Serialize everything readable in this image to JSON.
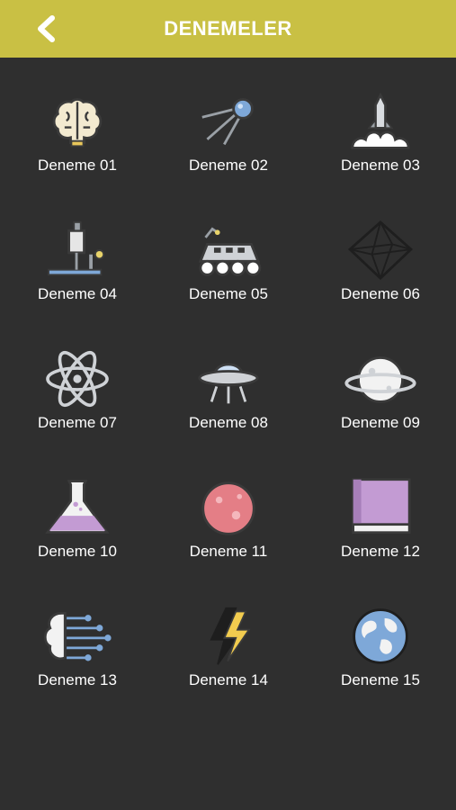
{
  "header": {
    "title": "DENEMELER",
    "back_icon": "chevron-left-icon",
    "background": "#c9c044"
  },
  "tests": [
    {
      "label": "Deneme 01",
      "icon": "brain-icon"
    },
    {
      "label": "Deneme 02",
      "icon": "satellite-icon"
    },
    {
      "label": "Deneme 03",
      "icon": "rocket-launch-icon"
    },
    {
      "label": "Deneme 04",
      "icon": "microscope-icon"
    },
    {
      "label": "Deneme 05",
      "icon": "rover-icon"
    },
    {
      "label": "Deneme 06",
      "icon": "octahedron-icon"
    },
    {
      "label": "Deneme 07",
      "icon": "atom-icon"
    },
    {
      "label": "Deneme 08",
      "icon": "ufo-icon"
    },
    {
      "label": "Deneme 09",
      "icon": "planet-ring-icon"
    },
    {
      "label": "Deneme 10",
      "icon": "flask-icon"
    },
    {
      "label": "Deneme 11",
      "icon": "planet-icon"
    },
    {
      "label": "Deneme 12",
      "icon": "book-icon"
    },
    {
      "label": "Deneme 13",
      "icon": "ai-brain-icon"
    },
    {
      "label": "Deneme 14",
      "icon": "lightning-icon"
    },
    {
      "label": "Deneme 15",
      "icon": "globe-icon"
    }
  ]
}
